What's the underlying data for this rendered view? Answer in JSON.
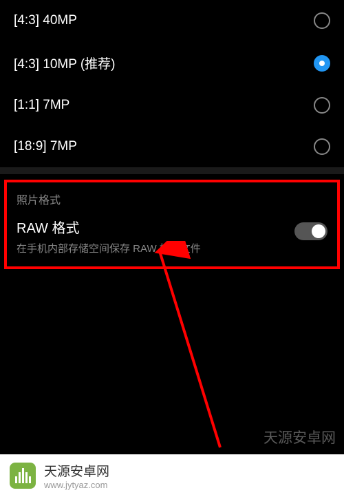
{
  "resolutions": [
    {
      "label": "[4:3] 40MP",
      "selected": false
    },
    {
      "label": "[4:3] 10MP (推荐)",
      "selected": true
    },
    {
      "label": "[1:1] 7MP",
      "selected": false
    },
    {
      "label": "[18:9] 7MP",
      "selected": false
    }
  ],
  "format_section": {
    "header": "照片格式",
    "toggle_title": "RAW 格式",
    "toggle_description": "在手机内部存储空间保存 RAW 格式文件"
  },
  "footer": {
    "title": "天源安卓网",
    "url": "www.jytyaz.com"
  },
  "watermark": "天源安卓网"
}
